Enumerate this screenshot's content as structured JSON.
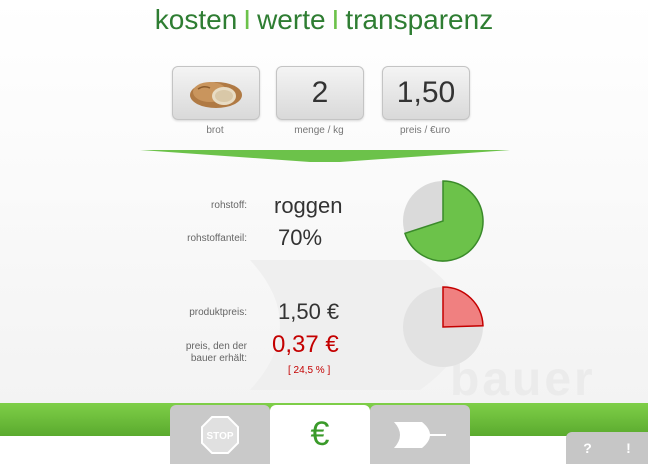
{
  "header": {
    "title_part1": "kosten",
    "title_part2": "werte",
    "title_part3": "transparenz",
    "separator": "I"
  },
  "tiles": [
    {
      "value": "",
      "label": "brot",
      "icon": "bread-icon"
    },
    {
      "value": "2",
      "label": "menge / kg"
    },
    {
      "value": "1,50",
      "label": "preis / €uro"
    }
  ],
  "rohstoff": {
    "label": "rohstoff:",
    "value": "roggen",
    "share_label": "rohstoffanteil:",
    "share_value": "70%",
    "share_fraction": 0.7
  },
  "preis": {
    "product_label": "produktpreis:",
    "product_value": "1,50 €",
    "farmer_label_line1": "preis, den der",
    "farmer_label_line2": "bauer erhält:",
    "farmer_value": "0,37 €",
    "farmer_percent": "[ 24,5 % ]",
    "farmer_fraction": 0.245
  },
  "watermark": {
    "text": "bauer"
  },
  "nav": {
    "tabs": [
      {
        "icon": "stop-icon",
        "label": "STOP"
      },
      {
        "icon": "euro-icon",
        "label": "€"
      },
      {
        "icon": "arrow-icon"
      }
    ],
    "help": "?",
    "info": "!"
  },
  "colors": {
    "title_green": "#2e7d32",
    "accent_green": "#6cc24a",
    "pie_green": "#6cc24a",
    "pie_red": "#f08080",
    "price_red": "#c40000"
  }
}
